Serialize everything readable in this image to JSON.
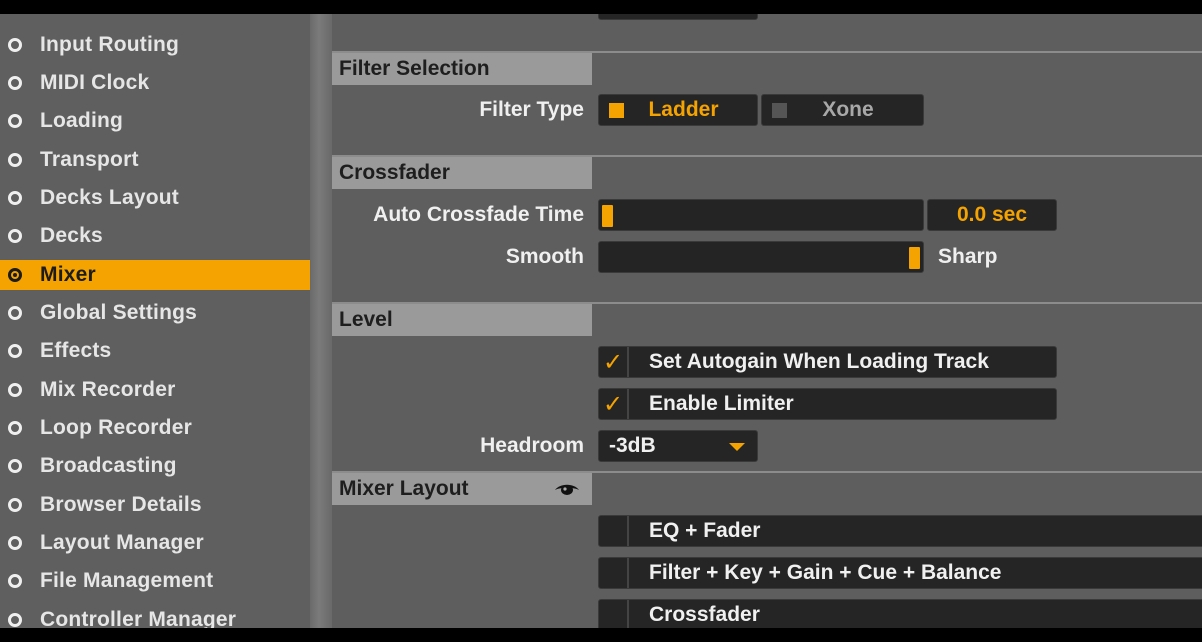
{
  "sidebar": {
    "items": [
      {
        "label": "Input Routing",
        "active": false
      },
      {
        "label": "MIDI Clock",
        "active": false
      },
      {
        "label": "Loading",
        "active": false
      },
      {
        "label": "Transport",
        "active": false
      },
      {
        "label": "Decks Layout",
        "active": false
      },
      {
        "label": "Decks",
        "active": false
      },
      {
        "label": "Mixer",
        "active": true
      },
      {
        "label": "Global Settings",
        "active": false
      },
      {
        "label": "Effects",
        "active": false
      },
      {
        "label": "Mix Recorder",
        "active": false
      },
      {
        "label": "Loop Recorder",
        "active": false
      },
      {
        "label": "Broadcasting",
        "active": false
      },
      {
        "label": "Browser Details",
        "active": false
      },
      {
        "label": "Layout Manager",
        "active": false
      },
      {
        "label": "File Management",
        "active": false
      },
      {
        "label": "Controller Manager",
        "active": false
      }
    ]
  },
  "filter": {
    "section_title": "Filter Selection",
    "type_label": "Filter Type",
    "options": [
      "Ladder",
      "Xone"
    ],
    "selected": "Ladder"
  },
  "crossfader": {
    "section_title": "Crossfader",
    "auto_label": "Auto Crossfade Time",
    "auto_value": "0.0 sec",
    "auto_fraction": 0.0,
    "curve_left_label": "Smooth",
    "curve_right_label": "Sharp",
    "curve_fraction": 1.0
  },
  "level": {
    "section_title": "Level",
    "autogain_label": "Set Autogain When Loading Track",
    "autogain_checked": true,
    "limiter_label": "Enable Limiter",
    "limiter_checked": true,
    "headroom_label": "Headroom",
    "headroom_value": "-3dB"
  },
  "mixer_layout": {
    "section_title": "Mixer Layout",
    "options": [
      {
        "label": "EQ + Fader",
        "checked": false
      },
      {
        "label": "Filter + Key + Gain + Cue + Balance",
        "checked": false
      },
      {
        "label": "Crossfader",
        "checked": false
      }
    ]
  },
  "colors": {
    "accent": "#f4a300",
    "panel": "#5e5e5e",
    "header": "#9a9a9a"
  },
  "icons": {
    "section_view": "eye-icon",
    "dropdown": "caret-down-icon",
    "check": "checkmark-icon"
  }
}
